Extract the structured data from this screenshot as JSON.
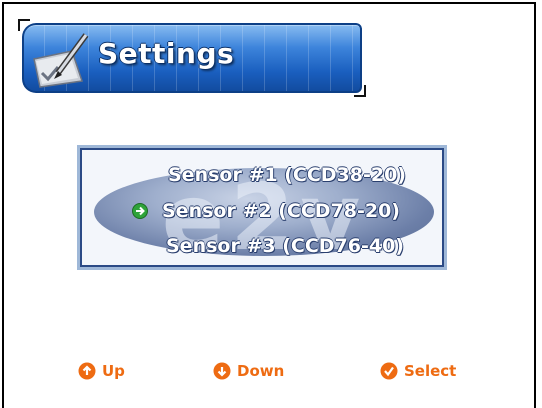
{
  "header": {
    "title": "Settings",
    "icon": "pencil-checklist-icon"
  },
  "logo": {
    "text": "e2v"
  },
  "sensors": {
    "items": [
      {
        "label": "Sensor #1 (CCD38-20)",
        "selected": false
      },
      {
        "label": "Sensor #2 (CCD78-20)",
        "selected": true
      },
      {
        "label": "Sensor #3 (CCD76-40)",
        "selected": false
      }
    ]
  },
  "softkeys": {
    "up": {
      "label": "Up",
      "icon": "up-arrow-circle-icon"
    },
    "down": {
      "label": "Down",
      "icon": "down-arrow-circle-icon"
    },
    "select": {
      "label": "Select",
      "icon": "check-circle-icon"
    }
  },
  "colors": {
    "header_blue": "#1a5fbf",
    "softkey_orange": "#ee6b12",
    "selection_green": "#2ea33a"
  }
}
